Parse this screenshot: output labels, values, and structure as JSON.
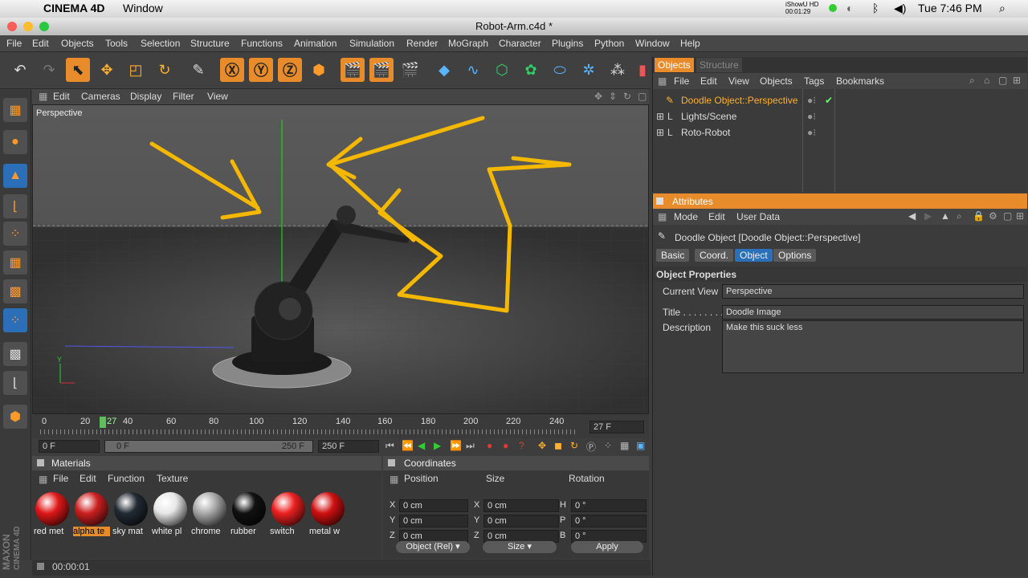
{
  "mac_menubar": {
    "app": "CINEMA 4D",
    "window": "Window",
    "recorder": "iShowU HD",
    "recorder_time": "00:01:29",
    "clock": "Tue 7:46 PM"
  },
  "window": {
    "title": "Robot-Arm.c4d *"
  },
  "menu": [
    "File",
    "Edit",
    "Objects",
    "Tools",
    "Selection",
    "Structure",
    "Functions",
    "Animation",
    "Simulation",
    "Render",
    "MoGraph",
    "Character",
    "Plugins",
    "Python",
    "Window",
    "Help"
  ],
  "viewport": {
    "menu": [
      "Edit",
      "Cameras",
      "Display",
      "Filter",
      "View"
    ],
    "label": "Perspective"
  },
  "timeline": {
    "ticks": [
      "0",
      "20",
      "27",
      "40",
      "60",
      "80",
      "100",
      "120",
      "140",
      "160",
      "180",
      "200",
      "220",
      "240"
    ],
    "current_frame": "27 F",
    "start": "0 F",
    "range_start": "0 F",
    "range_end": "250 F",
    "end": "250 F"
  },
  "materials": {
    "title": "Materials",
    "menu": [
      "File",
      "Edit",
      "Function",
      "Texture"
    ],
    "items": [
      {
        "label": "red met",
        "color": "#e01818"
      },
      {
        "label": "alpha te",
        "color": "#cc2020"
      },
      {
        "label": "sky mat",
        "color": "#222a33"
      },
      {
        "label": "white pl",
        "color": "#e8e8e8"
      },
      {
        "label": "chrome",
        "color": "#aaaaaa"
      },
      {
        "label": "rubber",
        "color": "#111111"
      },
      {
        "label": "switch",
        "color": "#ee2020"
      },
      {
        "label": "metal w",
        "color": "#d01010"
      }
    ]
  },
  "coordinates": {
    "title": "Coordinates",
    "headers": [
      "Position",
      "Size",
      "Rotation"
    ],
    "rows": [
      {
        "a": "X",
        "pos": "0 cm",
        "b": "X",
        "size": "0 cm",
        "c": "H",
        "rot": "0 °"
      },
      {
        "a": "Y",
        "pos": "0 cm",
        "b": "Y",
        "size": "0 cm",
        "c": "P",
        "rot": "0 °"
      },
      {
        "a": "Z",
        "pos": "0 cm",
        "b": "Z",
        "size": "0 cm",
        "c": "B",
        "rot": "0 °"
      }
    ],
    "mode": "Object (Rel)",
    "size_mode": "Size",
    "apply": "Apply"
  },
  "status": {
    "time": "00:00:01"
  },
  "maxon": {
    "line1": "MAXON",
    "line2": "CINEMA 4D"
  },
  "objects_panel": {
    "tabs": [
      "Objects",
      "Structure"
    ],
    "menu": [
      "File",
      "Edit",
      "View",
      "Objects",
      "Tags",
      "Bookmarks"
    ],
    "items": [
      "Doodle Object::Perspective",
      "Lights/Scene",
      "Roto-Robot"
    ]
  },
  "attributes": {
    "title": "Attributes",
    "menu": [
      "Mode",
      "Edit",
      "User Data"
    ],
    "object_name": "Doodle Object [Doodle Object::Perspective]",
    "tabs": [
      "Basic",
      "Coord.",
      "Object",
      "Options"
    ],
    "section": "Object Properties",
    "current_view_label": "Current View",
    "current_view": "Perspective",
    "title_label": "Title . . . . . . . .",
    "title_value": "Doodle Image",
    "description_label": "Description",
    "description_value": "Make this suck less"
  },
  "colors": {
    "accent": "#e88b2a",
    "selection": "#2b6fb8",
    "doodle": "#f5b800"
  }
}
